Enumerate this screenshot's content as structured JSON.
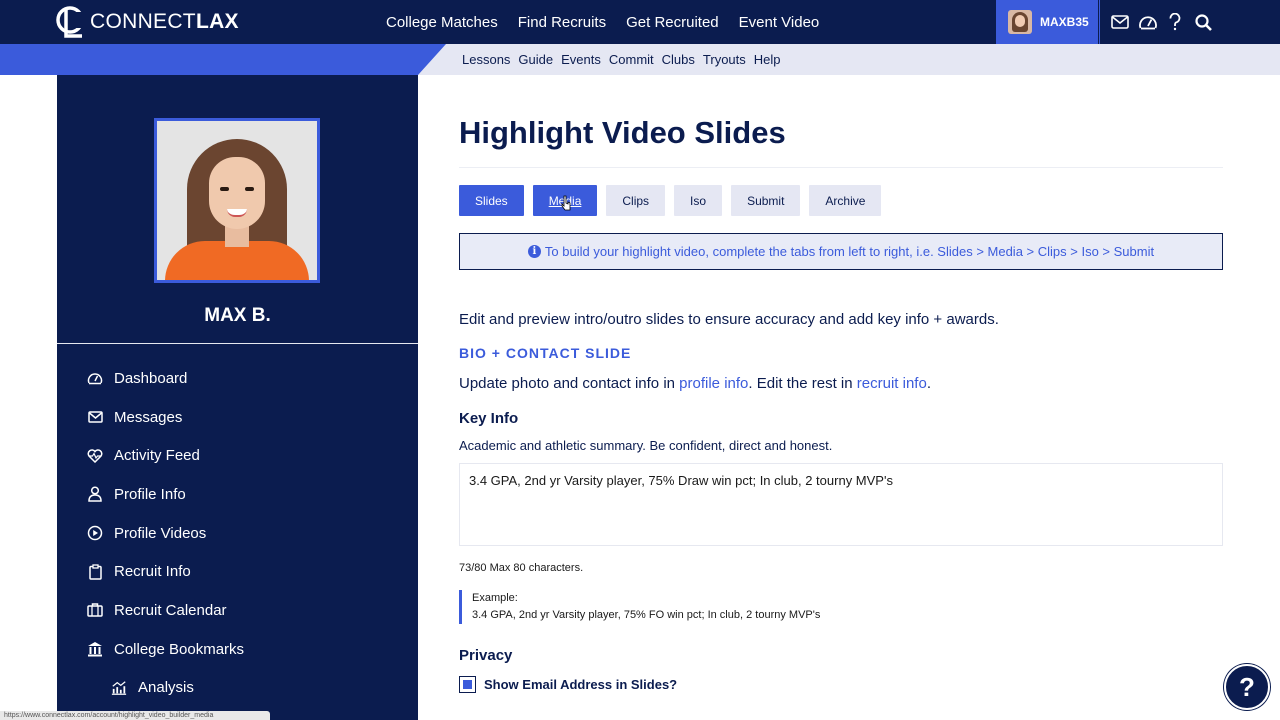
{
  "brand": {
    "name_part1": "CONNECT",
    "name_part2": "LAX"
  },
  "header": {
    "nav": [
      "College Matches",
      "Find Recruits",
      "Get Recruited",
      "Event Video"
    ],
    "username": "MAXB35"
  },
  "subnav": [
    "Lessons",
    "Guide",
    "Events",
    "Commit",
    "Clubs",
    "Tryouts",
    "Help"
  ],
  "sidebar": {
    "name": "MAX B.",
    "items": [
      {
        "label": "Dashboard",
        "icon": "dashboard-icon"
      },
      {
        "label": "Messages",
        "icon": "envelope-icon"
      },
      {
        "label": "Activity Feed",
        "icon": "heartbeat-icon"
      },
      {
        "label": "Profile Info",
        "icon": "user-icon"
      },
      {
        "label": "Profile Videos",
        "icon": "play-icon"
      },
      {
        "label": "Recruit Info",
        "icon": "clipboard-icon"
      },
      {
        "label": "Recruit Calendar",
        "icon": "calendar-icon"
      },
      {
        "label": "College Bookmarks",
        "icon": "university-icon"
      },
      {
        "label": "Analysis",
        "icon": "chart-icon"
      }
    ]
  },
  "main": {
    "title": "Highlight Video Slides",
    "tabs": [
      "Slides",
      "Media",
      "Clips",
      "Iso",
      "Submit",
      "Archive"
    ],
    "active_tab": "Slides",
    "info": "To build your highlight video, complete the tabs from left to right, i.e. Slides > Media > Clips > Iso > Submit",
    "intro": "Edit and preview intro/outro slides to ensure accuracy and add key info + awards.",
    "section_heading": "BIO + CONTACT SLIDE",
    "update_prefix": "Update photo and contact info in ",
    "update_link1": "profile info",
    "update_middle": ". Edit the rest in ",
    "update_link2": "recruit info",
    "update_suffix": ".",
    "key_info_heading": "Key Info",
    "key_info_sub": "Academic and athletic summary. Be confident, direct and honest.",
    "key_info_value": "3.4 GPA, 2nd yr Varsity player, 75% Draw win pct; In club, 2 tourny MVP's",
    "char_count": "73/80 Max 80 characters.",
    "example_label": "Example:",
    "example_text": "3.4 GPA, 2nd yr Varsity player, 75% FO win pct; In club, 2 tourny MVP's",
    "privacy_heading": "Privacy",
    "email_checkbox_label": "Show Email Address in Slides?",
    "email_checked": true
  },
  "help_label": "?",
  "status_url": "https://www.connectlax.com/account/highlight_video_builder_media",
  "colors": {
    "navy": "#0b1c4f",
    "accent": "#3b5bdb",
    "light": "#e5e7f3"
  }
}
